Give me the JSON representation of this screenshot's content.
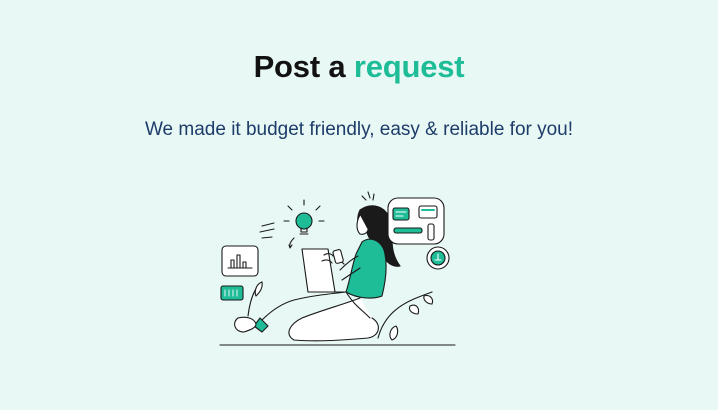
{
  "header": {
    "title_prefix": "Post a",
    "title_accent": "request",
    "subtitle": "We made it budget friendly, easy & reliable for you!"
  },
  "illustration": {
    "name": "woman-with-laptop-illustration"
  },
  "colors": {
    "background": "#e8f8f5",
    "title": "#121212",
    "accent": "#1fbc98",
    "subtitle": "#1d3c69",
    "ink": "#1a1a1a"
  }
}
